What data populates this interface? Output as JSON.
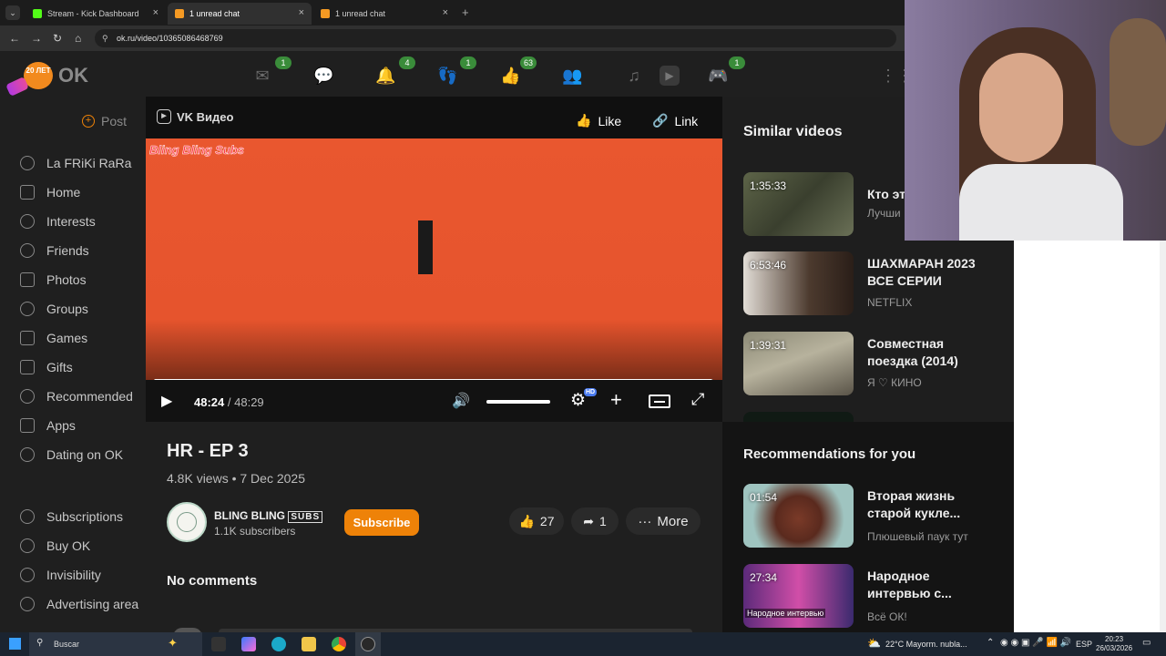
{
  "browser": {
    "tabs": [
      {
        "label": "Stream - Kick Dashboard",
        "favicon_color": "#53fc18"
      },
      {
        "label": "1 unread chat",
        "favicon_color": "#f59a23"
      },
      {
        "label": "1 unread chat",
        "favicon_color": "#f59a23"
      }
    ],
    "new_tab": "+",
    "url": "ok.ru/video/10365086468769"
  },
  "header": {
    "logo_badge": "20 ЛЕТ",
    "logo_text": "OK",
    "badges": {
      "messages": "1",
      "notifications": "4",
      "guests": "1",
      "likes": "63",
      "games": "1"
    }
  },
  "sidebar": {
    "post_label": "Post",
    "items": [
      "La FRiKi RaRa",
      "Home",
      "Interests",
      "Friends",
      "Photos",
      "Groups",
      "Games",
      "Gifts",
      "Recommended",
      "Apps",
      "Dating on OK"
    ],
    "bottom_items": [
      "Subscriptions",
      "Buy OK",
      "Invisibility",
      "Advertising area"
    ]
  },
  "player": {
    "brand": "VK Видео",
    "like_label": "Like",
    "link_label": "Link",
    "watermark": "Bling Bling Subs",
    "time_current": "48:24",
    "time_separator": "/",
    "time_total": "48:29",
    "progress": 0.998,
    "volume": 1.0,
    "quality_badge": "HD"
  },
  "video": {
    "title": "HR - EP 3",
    "meta": "4.8K views • 7 Dec 2025",
    "channel_name": "BLING BLING",
    "channel_tag": "SUBS",
    "subscribers": "1.1K subscribers",
    "subscribe_label": "Subscribe",
    "likes": "27",
    "shares": "1",
    "more_label": "More",
    "comments_label": "No comments"
  },
  "similar": {
    "heading": "Similar videos",
    "items": [
      {
        "duration": "1:35:33",
        "title": "Кто эт",
        "channel": "Лучши"
      },
      {
        "duration": "6:53:46",
        "title": "ШАХМАРАН 2023 ВСЕ СЕРИИ",
        "channel": "NETFLIX"
      },
      {
        "duration": "1:39:31",
        "title": "Совместная поездка (2014)",
        "channel": "Я ♡ КИНО"
      }
    ]
  },
  "recommendations": {
    "heading": "Recommendations for you",
    "items": [
      {
        "duration": "01:54",
        "title": "Вторая жизнь старой кукле...",
        "channel": "Плюшевый паук тут"
      },
      {
        "duration": "27:34",
        "title": "Народное интервью с...",
        "channel": "Всё ОК!",
        "thumb_caption": "Народное интервью"
      }
    ]
  },
  "taskbar": {
    "search": "Buscar",
    "weather": "22°C  Mayorm. nubla...",
    "lang": "ESP",
    "time": "20:23",
    "date": "26/03/2026"
  }
}
